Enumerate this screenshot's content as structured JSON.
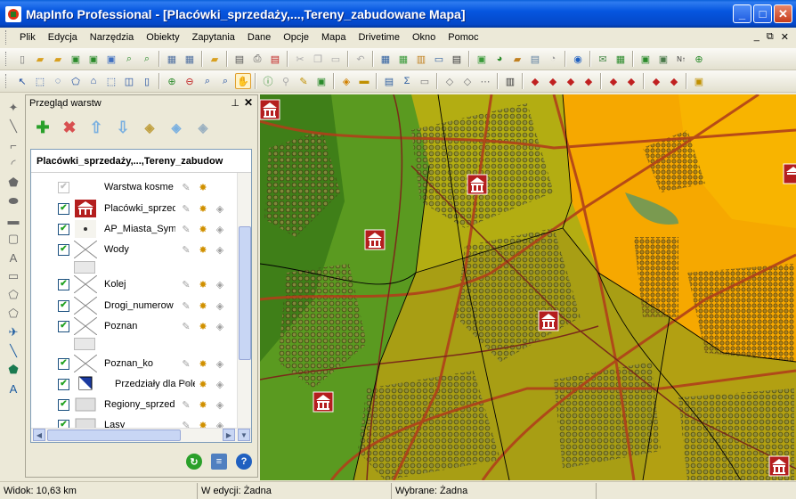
{
  "window": {
    "title": "MapInfo Professional - [Placówki_sprzedaży,...,Tereny_zabudowane Mapa]"
  },
  "menu": {
    "items": [
      "Plik",
      "Edycja",
      "Narzędzia",
      "Obiekty",
      "Zapytania",
      "Dane",
      "Opcje",
      "Mapa",
      "Drivetime",
      "Okno",
      "Pomoc"
    ]
  },
  "layer_panel": {
    "title": "Przegląd warstw",
    "map_name": "Placówki_sprzedaży,...,Tereny_zabudow",
    "layers": [
      {
        "name": "Warstwa kosme",
        "checked": true,
        "icon": "blank"
      },
      {
        "name": "Placówki_sprzed",
        "checked": true,
        "icon": "store-building-icon"
      },
      {
        "name": "AP_Miasta_Sym",
        "checked": true,
        "icon": "dot-symbol-icon"
      },
      {
        "name": "Wody",
        "checked": true,
        "icon": "no-style-icon"
      },
      {
        "name": "Kolej",
        "checked": true,
        "icon": "no-style-icon"
      },
      {
        "name": "Drogi_numerow",
        "checked": true,
        "icon": "no-style-icon"
      },
      {
        "name": "Poznan",
        "checked": true,
        "icon": "no-style-icon"
      },
      {
        "name": "Poznan_ko",
        "checked": true,
        "icon": "no-style-icon"
      },
      {
        "name": "Przedziały dla Pole",
        "checked": true,
        "icon": "range-fill-icon"
      },
      {
        "name": "Regiony_sprzed",
        "checked": true,
        "icon": "region-fill-icon"
      },
      {
        "name": "Lasy",
        "checked": true,
        "icon": "region-fill-icon"
      }
    ]
  },
  "status": {
    "view": "Widok: 10,63 km",
    "editing": "W edycji: Żadna",
    "selected": "Wybrane: Żadna"
  },
  "colors": {
    "title_bar": "#0656e0",
    "map_orange": "#f6a800",
    "map_olive": "#a49d10",
    "map_green": "#5a9a20",
    "store_marker": "#b41e1e"
  }
}
